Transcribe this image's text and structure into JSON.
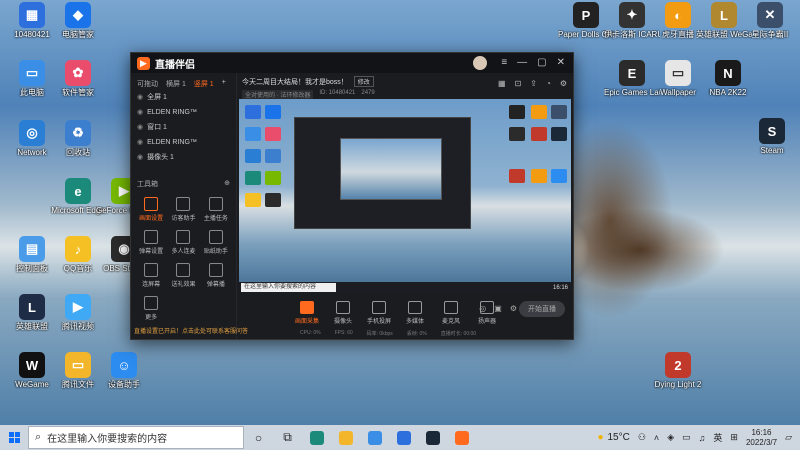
{
  "desktop_icons_left": [
    {
      "label": "10480421",
      "color": "#2d6fdc",
      "glyph": "▦"
    },
    {
      "label": "电脑管家",
      "color": "#1a73e8",
      "glyph": "◆"
    },
    {
      "label": "此电脑",
      "color": "#3a8ee6",
      "glyph": "▭"
    },
    {
      "label": "软件管家",
      "color": "#e94d6b",
      "glyph": "✿"
    },
    {
      "label": "Network",
      "color": "#2a7fd4",
      "glyph": "◎"
    },
    {
      "label": "回收站",
      "color": "#3d7fcf",
      "glyph": "♻"
    },
    {
      "label": "Microsoft Edge",
      "color": "#1b8a7a",
      "glyph": "e"
    },
    {
      "label": "GeForce Experience",
      "color": "#76b900",
      "glyph": "▶"
    },
    {
      "label": "控制面板",
      "color": "#4a9be8",
      "glyph": "▤"
    },
    {
      "label": "QQ音乐",
      "color": "#f4c023",
      "glyph": "♪"
    },
    {
      "label": "OBS Studio",
      "color": "#2b2b2b",
      "glyph": "◉"
    },
    {
      "label": "英雄联盟",
      "color": "#1e2c46",
      "glyph": "L"
    },
    {
      "label": "腾讯视频",
      "color": "#3fa9f5",
      "glyph": "▶"
    },
    {
      "label": "WeGame",
      "color": "#111111",
      "glyph": "W"
    },
    {
      "label": "腾讯文件",
      "color": "#f3b62b",
      "glyph": "▭"
    },
    {
      "label": "设备助手",
      "color": "#2d8cf0",
      "glyph": "☺"
    }
  ],
  "desktop_icons_right": [
    {
      "label": "Paper Dolls Original",
      "color": "#222222",
      "glyph": "P"
    },
    {
      "label": "伊卡洛斯 ICARUS",
      "color": "#333333",
      "glyph": "✦"
    },
    {
      "label": "虎牙直播",
      "color": "#f39c12",
      "glyph": "◐"
    },
    {
      "label": "英雄联盟 WeGame版",
      "color": "#b08830",
      "glyph": "L"
    },
    {
      "label": "星际争霸II",
      "color": "#3b4e6a",
      "glyph": "✕"
    },
    {
      "label": "Epic Games Launcher",
      "color": "#2b2b2b",
      "glyph": "E"
    },
    {
      "label": "Wallpaper",
      "color": "#e6e6e6",
      "glyph": "▭"
    },
    {
      "label": "NBA 2K22",
      "color": "#1a1a1a",
      "glyph": "N"
    },
    {
      "label": "Steam",
      "color": "#1b2838",
      "glyph": "S"
    },
    {
      "label": "Dying Light 2",
      "color": "#c0392b",
      "glyph": "2"
    }
  ],
  "app_window": {
    "app_name": "直播伴侣",
    "tabs": [
      "可拖动",
      "横屏 1",
      "竖屏 1",
      "+"
    ],
    "scenes": [
      "全屏 1",
      "ELDEN RING™",
      "窗口 1",
      "ELDEN RING™",
      "摄像头 1"
    ],
    "tools_header": "工具箱",
    "tools": [
      "画面设置",
      "访客助手",
      "主播任务",
      "弹幕设置",
      "多人连麦",
      "贴纸助手",
      "连屏幕",
      "送礼效果",
      "弹幕播",
      "更多"
    ],
    "notice": "直播设置已开启！点击此处可联系客服问答",
    "room_title": "今天二周目大结局！我才是boss！",
    "edit_label": "修改",
    "room_tag": "全对使用的 · 法环修改器",
    "room_id": "ID: 10480421",
    "fans": "2479",
    "controls": [
      "画面采集",
      "摄像头",
      "手机投屏",
      "多媒体",
      "麦克风",
      "扬声器"
    ],
    "start_button": "开始直播",
    "stats": [
      "CPU: 0%",
      "FPS: 60",
      "码率: 0kbps",
      "丢帧: 0%",
      "直播时长: 00:00"
    ]
  },
  "taskbar": {
    "search_placeholder": "在这里输入你要搜索的内容",
    "weather": "15°C",
    "ime": "英",
    "time": "16:16",
    "date": "2022/3/7"
  }
}
